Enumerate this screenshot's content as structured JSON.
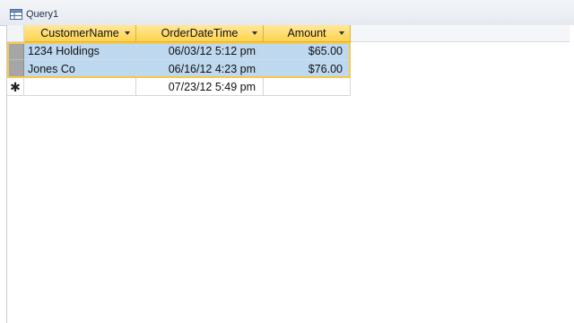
{
  "tab": {
    "title": "Query1",
    "icon": "query-datasheet-icon"
  },
  "grid": {
    "columns": [
      {
        "label": "CustomerName"
      },
      {
        "label": "OrderDateTime"
      },
      {
        "label": "Amount"
      }
    ],
    "rows": [
      {
        "CustomerName": "1234 Holdings",
        "OrderDateTime": "06/03/12 5:12 pm",
        "Amount": "$65.00"
      },
      {
        "CustomerName": "Jones Co",
        "OrderDateTime": "06/16/12 4:23 pm",
        "Amount": "$76.00"
      }
    ],
    "new_record": {
      "marker": "✱",
      "CustomerName": "",
      "OrderDateTime": "07/23/12 5:49 pm",
      "Amount": ""
    }
  },
  "colors": {
    "header": "#ffd34e",
    "selected_row": "#bed8f0",
    "selection_outline": "#f6c94d"
  }
}
